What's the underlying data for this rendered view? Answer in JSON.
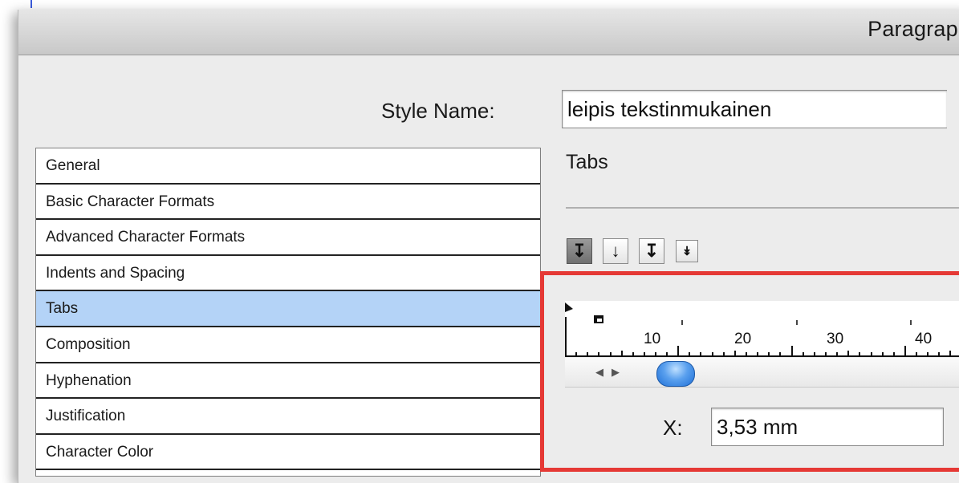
{
  "window": {
    "title": "Paragraph"
  },
  "style_name": {
    "label": "Style Name:",
    "value": "leipis tekstinmukainen"
  },
  "categories": [
    {
      "label": "General"
    },
    {
      "label": "Basic Character Formats"
    },
    {
      "label": "Advanced Character Formats"
    },
    {
      "label": "Indents and Spacing"
    },
    {
      "label": "Tabs",
      "selected": true
    },
    {
      "label": "Composition"
    },
    {
      "label": "Hyphenation"
    },
    {
      "label": "Justification"
    },
    {
      "label": "Character Color"
    }
  ],
  "tabs_panel": {
    "heading": "Tabs",
    "alignment_buttons": [
      {
        "icon": "left-justified-tab-icon",
        "glyph": "↧",
        "active": true
      },
      {
        "icon": "center-justified-tab-icon",
        "glyph": "↓",
        "active": false
      },
      {
        "icon": "right-justified-tab-icon",
        "glyph": "↧",
        "active": false
      },
      {
        "icon": "decimal-tab-icon",
        "glyph": "↡",
        "active": false
      }
    ],
    "ruler": {
      "labels": [
        "10",
        "20",
        "30",
        "40"
      ]
    },
    "x_position": {
      "label": "X:",
      "value": "3,53 mm"
    }
  },
  "colors": {
    "highlight": "#e53935",
    "selection": "#b4d3f7"
  }
}
